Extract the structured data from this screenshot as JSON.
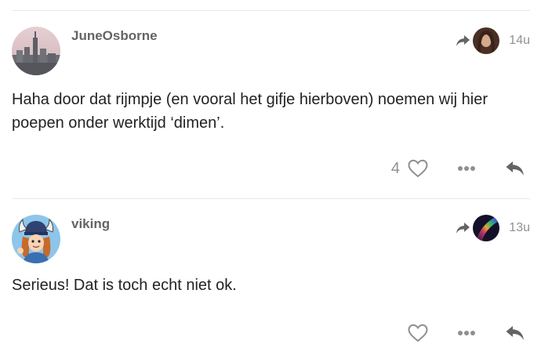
{
  "posts": [
    {
      "username": "JuneOsborne",
      "avatar_icon": "city-skyline-avatar",
      "reply_to_avatar_icon": "woman-portrait-avatar",
      "time": "14u",
      "body": "Haha door dat rijmpje (en vooral het gifje hierboven) noemen wij hier poepen onder werktijd ‘dimen’.",
      "like_count": "4"
    },
    {
      "username": "viking",
      "avatar_icon": "viking-cartoon-avatar",
      "reply_to_avatar_icon": "aurora-avatar",
      "time": "13u",
      "body": "Serieus! Dat is toch echt niet ok.",
      "like_count": ""
    }
  ],
  "icons": {
    "reply_to": "share-arrow-icon",
    "like": "heart-icon",
    "more": "ellipsis-icon",
    "reply": "reply-icon"
  },
  "colors": {
    "text": "#222222",
    "muted": "#919191",
    "username": "#646464",
    "divider": "#e9e9e9"
  }
}
